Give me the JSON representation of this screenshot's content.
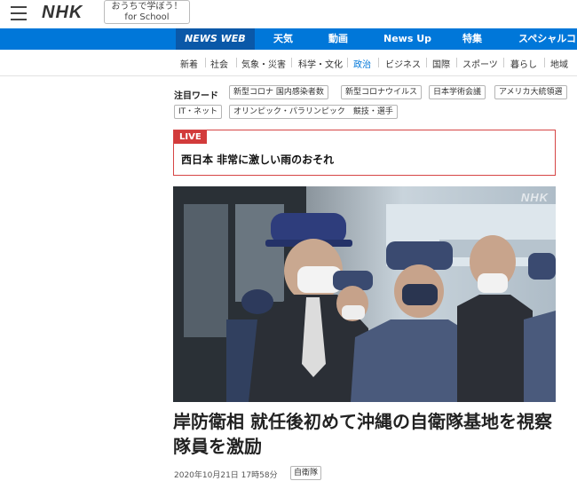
{
  "header": {
    "logo": "NHK",
    "school_line1": "おうちで学ぼう！",
    "school_line2": "for School"
  },
  "main_nav": [
    "NEWS WEB",
    "天気",
    "動画",
    "News Up",
    "特集",
    "スペシャルコ"
  ],
  "sub_nav": [
    "新着",
    "社会",
    "気象・災害",
    "科学・文化",
    "政治",
    "ビジネス",
    "国際",
    "スポーツ",
    "暮らし",
    "地域"
  ],
  "sub_nav_active": "政治",
  "keywords": {
    "label": "注目ワード",
    "tags": [
      "新型コロナ 国内感染者数",
      "新型コロナウイルス",
      "日本学術会議",
      "アメリカ大統領選",
      "IT・ネット",
      "オリンピック・パラリンピック　競技・選手"
    ]
  },
  "live": {
    "badge": "LIVE",
    "title": "西日本  非常に激しい雨のおそれ"
  },
  "article": {
    "photo_watermark": "NHK",
    "headline": "岸防衛相 就任後初めて沖縄の自衛隊基地を視察 隊員を激励",
    "date": "2020年10月21日 17時58分",
    "category": "自衛隊"
  },
  "colors": {
    "nav_blue": "#0077d9",
    "nav_active": "#0a58a8",
    "live_red": "#d23b3b"
  }
}
